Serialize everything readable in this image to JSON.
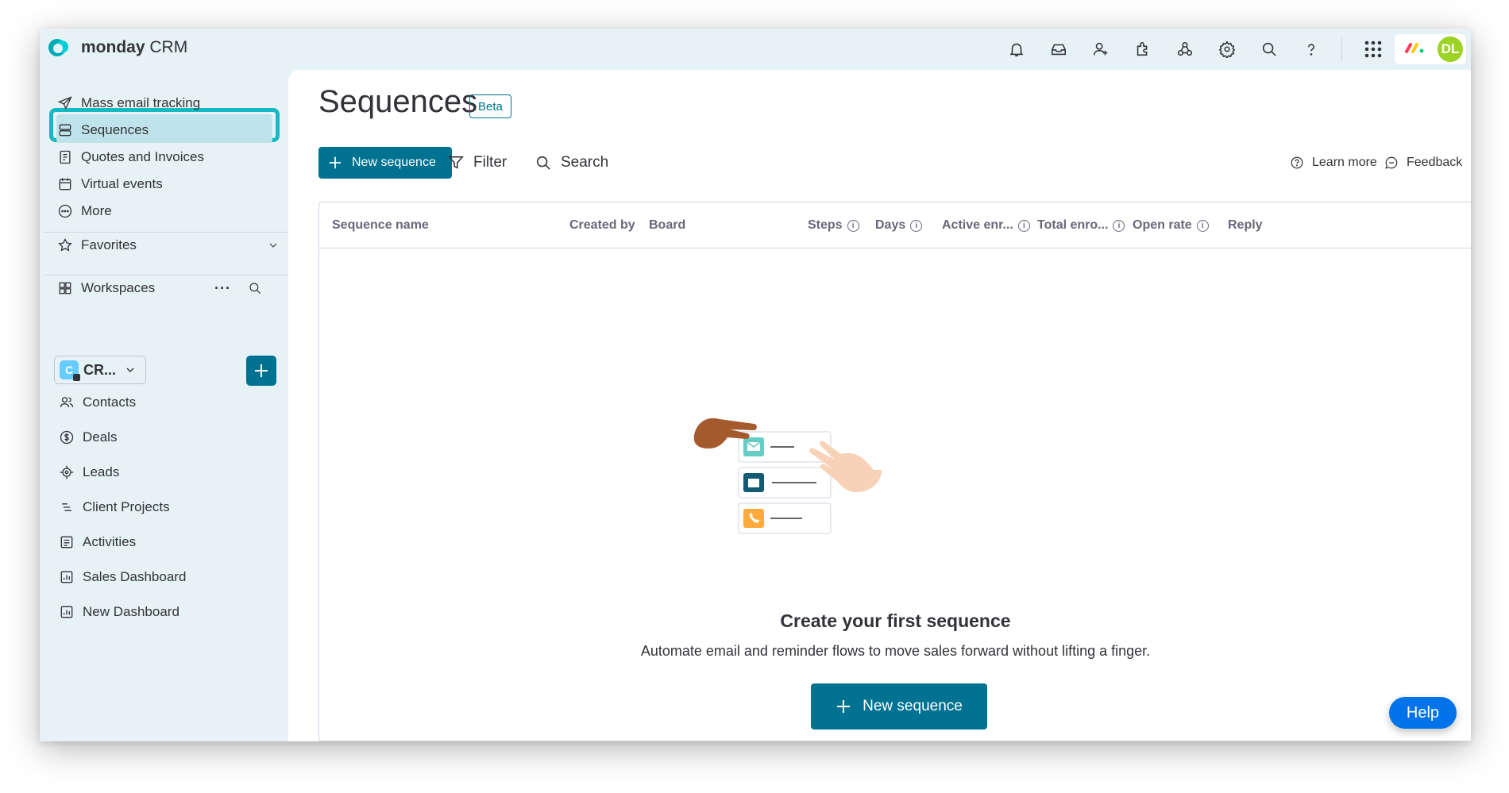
{
  "app": {
    "brand_bold": "monday",
    "brand_light": "CRM"
  },
  "topbar": {
    "icons": [
      "bell-icon",
      "inbox-icon",
      "invite-members-icon",
      "apps-icon",
      "integrations-icon",
      "settings-icon",
      "search-icon",
      "help-icon",
      "app-grid-icon"
    ],
    "avatar_initials": "DL",
    "avatar_color": "#9cd326"
  },
  "sidebar": {
    "top_items": [
      {
        "label": "Mass email tracking",
        "icon": "paper-plane-icon"
      },
      {
        "label": "Sequences",
        "icon": "sequences-icon"
      },
      {
        "label": "Quotes and Invoices",
        "icon": "invoice-icon"
      },
      {
        "label": "Virtual events",
        "icon": "calendar-icon"
      },
      {
        "label": "More",
        "icon": "more-circle-icon"
      }
    ],
    "favorites_label": "Favorites",
    "workspaces_label": "Workspaces",
    "workspace_name": "CR...",
    "workspace_initial": "C",
    "boards": [
      {
        "label": "Contacts",
        "icon": "contacts-icon"
      },
      {
        "label": "Deals",
        "icon": "dollar-icon"
      },
      {
        "label": "Leads",
        "icon": "target-icon"
      },
      {
        "label": "Client Projects",
        "icon": "list-icon"
      },
      {
        "label": "Activities",
        "icon": "board-icon"
      },
      {
        "label": "Sales Dashboard",
        "icon": "dashboard-icon"
      },
      {
        "label": "New Dashboard",
        "icon": "dashboard-icon"
      }
    ]
  },
  "main": {
    "title": "Sequences",
    "badge": "Beta",
    "new_sequence_label": "New sequence",
    "filter_label": "Filter",
    "search_label": "Search",
    "learn_more_label": "Learn more",
    "feedback_label": "Feedback",
    "columns": [
      "Sequence name",
      "Created by",
      "Board",
      "Steps",
      "Days",
      "Active enr...",
      "Total enro...",
      "Open rate",
      "Reply"
    ],
    "empty_title": "Create your first sequence",
    "empty_description": "Automate email and reminder flows to move sales forward without lifting a finger.",
    "empty_button_label": "New sequence",
    "help_label": "Help",
    "accent_color": "#007291"
  }
}
